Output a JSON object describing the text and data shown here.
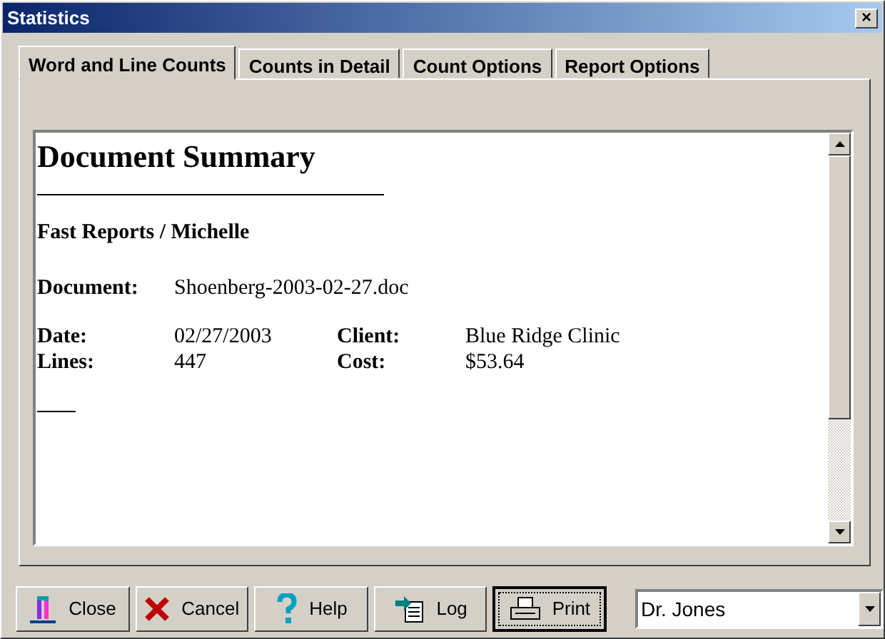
{
  "window": {
    "title": "Statistics",
    "close": "×"
  },
  "tabs": [
    {
      "label": "Word and Line Counts",
      "selected": true
    },
    {
      "label": "Counts in Detail",
      "selected": false
    },
    {
      "label": "Count Options",
      "selected": false
    },
    {
      "label": "Report Options",
      "selected": false
    }
  ],
  "document": {
    "heading": "Document Summary",
    "subtitle": "Fast Reports / Michelle",
    "document_label": "Document:",
    "document_value": "Shoenberg-2003-02-27.doc",
    "fields": [
      [
        {
          "label": "Date:",
          "value": "02/27/2003"
        },
        {
          "label": "Client:",
          "value": "Blue Ridge Clinic"
        }
      ],
      [
        {
          "label": "Lines:",
          "value": "447"
        },
        {
          "label": "Cost:",
          "value": "$53.64"
        }
      ]
    ]
  },
  "buttons": [
    {
      "label": "Close",
      "kind": "close",
      "focused": false
    },
    {
      "label": "Cancel",
      "kind": "cancel",
      "focused": false
    },
    {
      "label": "Help",
      "kind": "help",
      "focused": false
    },
    {
      "label": "Log",
      "kind": "log",
      "focused": false
    },
    {
      "label": "Print",
      "kind": "print",
      "focused": true
    }
  ],
  "user_select": {
    "value": "Dr. Jones"
  }
}
